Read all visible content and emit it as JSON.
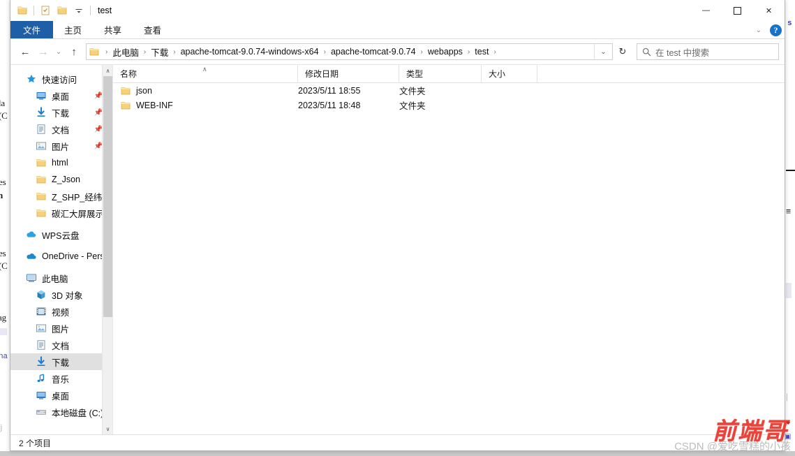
{
  "window": {
    "title": "test",
    "quick_access": [
      "folder-icon",
      "properties-icon",
      "new-folder-icon",
      "customize-dropdown-icon"
    ],
    "controls": {
      "minimize": "—",
      "maximize": "☐",
      "close": "✕"
    }
  },
  "ribbon": {
    "tabs": [
      {
        "label": "文件",
        "active": true
      },
      {
        "label": "主页",
        "active": false
      },
      {
        "label": "共享",
        "active": false
      },
      {
        "label": "查看",
        "active": false
      }
    ],
    "collapse_label": "⌄",
    "help_label": "?"
  },
  "address": {
    "back": "←",
    "forward": "→",
    "recent": "⌄",
    "up": "↑",
    "breadcrumbs": [
      "此电脑",
      "下载",
      "apache-tomcat-9.0.74-windows-x64",
      "apache-tomcat-9.0.74",
      "webapps",
      "test"
    ],
    "separator": "›",
    "dropdown": "⌄",
    "refresh": "↻"
  },
  "search": {
    "placeholder": "在 test 中搜索",
    "icon": "search-icon"
  },
  "sidebar": {
    "groups": [
      {
        "header": {
          "label": "快速访问",
          "icon": "star-icon"
        },
        "items": [
          {
            "label": "桌面",
            "icon": "desktop-icon",
            "pinned": true
          },
          {
            "label": "下载",
            "icon": "download-icon",
            "pinned": true
          },
          {
            "label": "文档",
            "icon": "documents-icon",
            "pinned": true
          },
          {
            "label": "图片",
            "icon": "pictures-icon",
            "pinned": true
          },
          {
            "label": "html",
            "icon": "folder-icon",
            "pinned": false
          },
          {
            "label": "Z_Json",
            "icon": "folder-icon",
            "pinned": false
          },
          {
            "label": "Z_SHP_经纬度",
            "icon": "folder-icon",
            "pinned": false
          },
          {
            "label": "碳汇大屏展示_V",
            "icon": "folder-icon",
            "pinned": false
          }
        ]
      },
      {
        "header": {
          "label": "WPS云盘",
          "icon": "cloud-icon"
        },
        "items": []
      },
      {
        "header": {
          "label": "OneDrive - Pers",
          "icon": "onedrive-icon"
        },
        "items": []
      },
      {
        "header": {
          "label": "此电脑",
          "icon": "this-pc-icon"
        },
        "items": [
          {
            "label": "3D 对象",
            "icon": "3d-objects-icon",
            "pinned": false
          },
          {
            "label": "视频",
            "icon": "videos-icon",
            "pinned": false
          },
          {
            "label": "图片",
            "icon": "pictures-icon",
            "pinned": false
          },
          {
            "label": "文档",
            "icon": "documents-icon",
            "pinned": false
          },
          {
            "label": "下载",
            "icon": "download-icon",
            "pinned": false,
            "selected": true
          },
          {
            "label": "音乐",
            "icon": "music-icon",
            "pinned": false
          },
          {
            "label": "桌面",
            "icon": "desktop-icon",
            "pinned": false
          },
          {
            "label": "本地磁盘 (C:)",
            "icon": "drive-icon",
            "pinned": false
          }
        ]
      }
    ],
    "scroll_up": "∧",
    "scroll_down": "∨"
  },
  "file_list": {
    "columns": [
      {
        "key": "name",
        "label": "名称",
        "sorted": true,
        "sort_dir": "asc"
      },
      {
        "key": "date",
        "label": "修改日期"
      },
      {
        "key": "type",
        "label": "类型"
      },
      {
        "key": "size",
        "label": "大小"
      }
    ],
    "sort_caret": "∧",
    "rows": [
      {
        "name": "json",
        "icon": "folder-icon",
        "date": "2023/5/11 18:55",
        "type": "文件夹",
        "size": ""
      },
      {
        "name": "WEB-INF",
        "icon": "folder-icon",
        "date": "2023/5/11 18:48",
        "type": "文件夹",
        "size": ""
      }
    ]
  },
  "status": {
    "text": "2 个项目"
  },
  "watermark": {
    "csdn": "CSDN @爱吃雪糕的小孩",
    "red": "前端哥"
  },
  "background": {
    "left_fragments": [
      "la",
      "(C",
      "es",
      "n",
      "es",
      "(C",
      "ag",
      "na"
    ],
    "right_fragments": [
      "s",
      "—",
      "☰"
    ]
  },
  "colors": {
    "ribbon_file_tab": "#1f5fa8",
    "folder_yellow": "#ffd470",
    "accent_blue": "#1673c8",
    "selection_gray": "#e0e0e0",
    "watermark_red": "#e8342a"
  }
}
